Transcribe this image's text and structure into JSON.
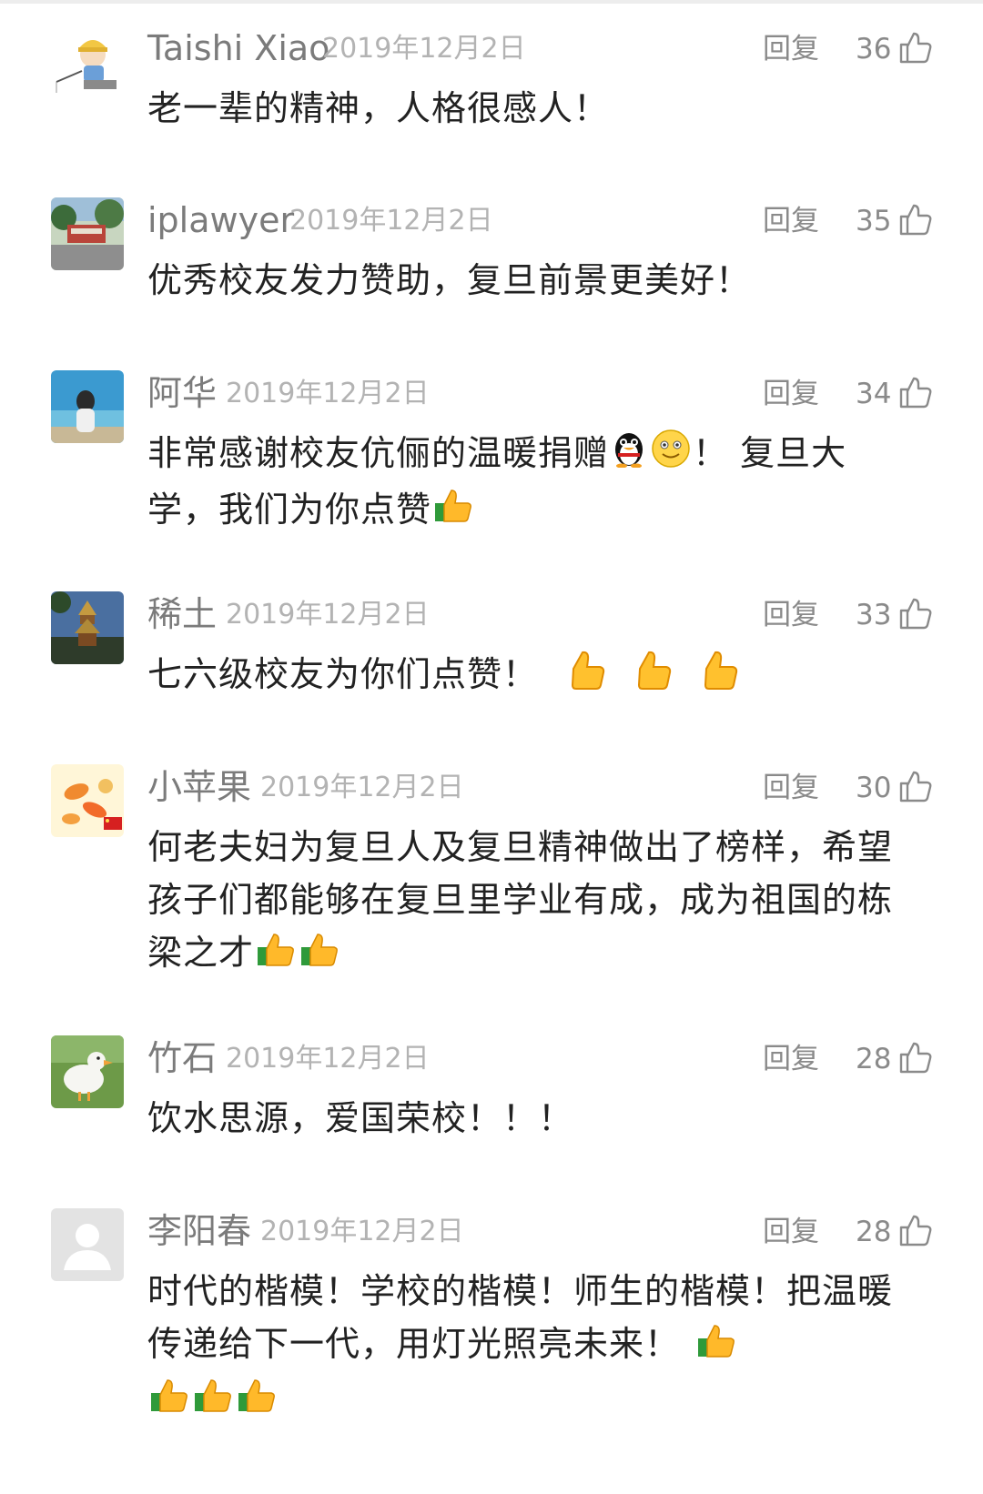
{
  "ui": {
    "reply_label": "回复"
  },
  "comments": [
    {
      "user": "Taishi Xiao",
      "date": "2019年12月2日",
      "likes": "36",
      "avatar": "child-fishing-avatar",
      "text": "老一辈的精神，人格很感人！"
    },
    {
      "user": "iplawyer",
      "date": "2019年12月2日",
      "likes": "35",
      "avatar": "campus-photo-avatar",
      "text": "优秀校友发力赞助，复旦前景更美好！"
    },
    {
      "user": "阿华",
      "date": "2019年12月2日",
      "likes": "34",
      "avatar": "seaside-woman-avatar",
      "text_line1": "非常感谢校友伉俪的温暖捐赠",
      "text_after_emoji": "！ 复旦大",
      "text_line2": "学，我们为你点赞"
    },
    {
      "user": "稀土",
      "date": "2019年12月2日",
      "likes": "33",
      "avatar": "pagoda-avatar",
      "text": "七六级校友为你们点赞！"
    },
    {
      "user": "小苹果",
      "date": "2019年12月2日",
      "likes": "30",
      "avatar": "goldfish-avatar",
      "text_line1": "何老夫妇为复旦人及复旦精神做出了榜样，希望",
      "text_line2": "孩子们都能够在复旦里学业有成，成为祖国的栋",
      "text_line3": "梁之才"
    },
    {
      "user": "竹石",
      "date": "2019年12月2日",
      "likes": "28",
      "avatar": "white-duck-avatar",
      "text": "饮水思源，爱国荣校！！！"
    },
    {
      "user": "李阳春",
      "date": "2019年12月2日",
      "likes": "28",
      "avatar": "default-avatar",
      "text_line1": "时代的楷模！学校的楷模！师生的楷模！把温暖",
      "text_line2": "传递给下一代，用灯光照亮未来！"
    }
  ],
  "colors": {
    "name": "#7b7b7b",
    "date": "#b3b3b3",
    "text": "#222222",
    "meta": "#8a8a8a"
  }
}
